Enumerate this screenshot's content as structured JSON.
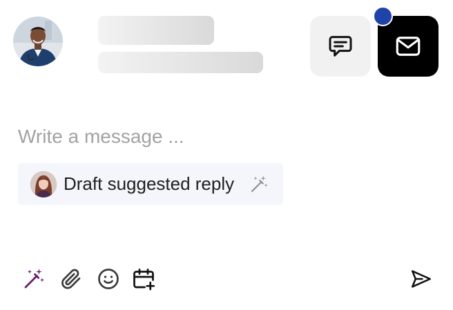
{
  "header": {
    "avatar_icon": "doctor-avatar",
    "chat_button_icon": "message-square-icon",
    "mail_button_icon": "mail-icon",
    "notification_color": "#1f43a8"
  },
  "composer": {
    "placeholder": "Write a message ..."
  },
  "suggestion": {
    "label": "Draft suggested reply",
    "avatar_icon": "woman-avatar",
    "action_icon": "magic-wand-icon"
  },
  "toolbar": {
    "tools": [
      "magic-wand-icon",
      "paperclip-icon",
      "smile-icon",
      "calendar-plus-icon"
    ],
    "send_icon": "send-icon",
    "accent_color": "#6a1b6e"
  }
}
